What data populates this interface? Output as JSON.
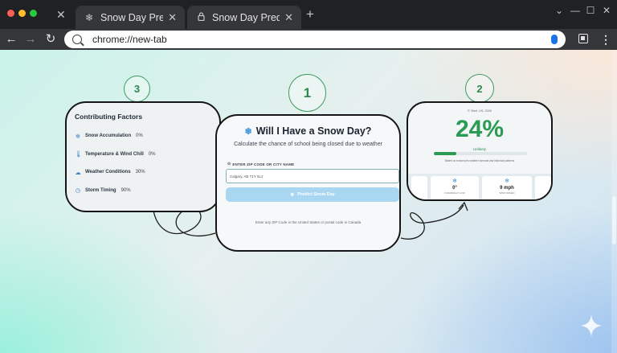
{
  "browser": {
    "tabs": [
      {
        "title": "Snow Day Predictor",
        "icon": "snowflake-icon",
        "active": true
      },
      {
        "title": "Snow Day Predictor",
        "icon": "lock-icon",
        "active": false
      }
    ],
    "url": "chrome://new-tab"
  },
  "badges": {
    "one": "1",
    "two": "2",
    "three": "3"
  },
  "factors": {
    "title": "Contributing Factors",
    "items": [
      {
        "icon": "snowflake-icon",
        "glyph": "❄",
        "label": "Snow Accumulation",
        "value": "0%"
      },
      {
        "icon": "thermometer-icon",
        "glyph": "🌡",
        "label": "Temperature & Wind Chill",
        "value": "0%"
      },
      {
        "icon": "cloud-icon",
        "glyph": "☁",
        "label": "Weather Conditions",
        "value": "30%"
      },
      {
        "icon": "clock-icon",
        "glyph": "◷",
        "label": "Storm Timing",
        "value": "90%"
      }
    ]
  },
  "predictor": {
    "title": "Will I Have a Snow Day?",
    "subtitle": "Calculate the chance of school being closed due to weather",
    "field_label": "ENTER ZIP CODE OR CITY NAME",
    "input_value": "Calgary, AB T1Y 5L2",
    "button_label": "Predict Snow Day",
    "help_text": "Enter any ZIP Code in the United States or postal code in Canada"
  },
  "result": {
    "header": "© Start, US, 2026",
    "percent": "24%",
    "percent_value": 0.24,
    "label": "Unlikely",
    "note": "Based on tomorrow's weather forecast and historical patterns",
    "stats": [
      {
        "icon": "snowflake-icon",
        "value": "0°",
        "label": "OVERNIGHT LOW"
      },
      {
        "icon": "wind-icon",
        "value": "9 mph",
        "label": "WIND SPEED"
      }
    ]
  },
  "colors": {
    "accent": "#2b9a52",
    "badge": "#3e9a5e",
    "button": "#a9d6f0"
  }
}
